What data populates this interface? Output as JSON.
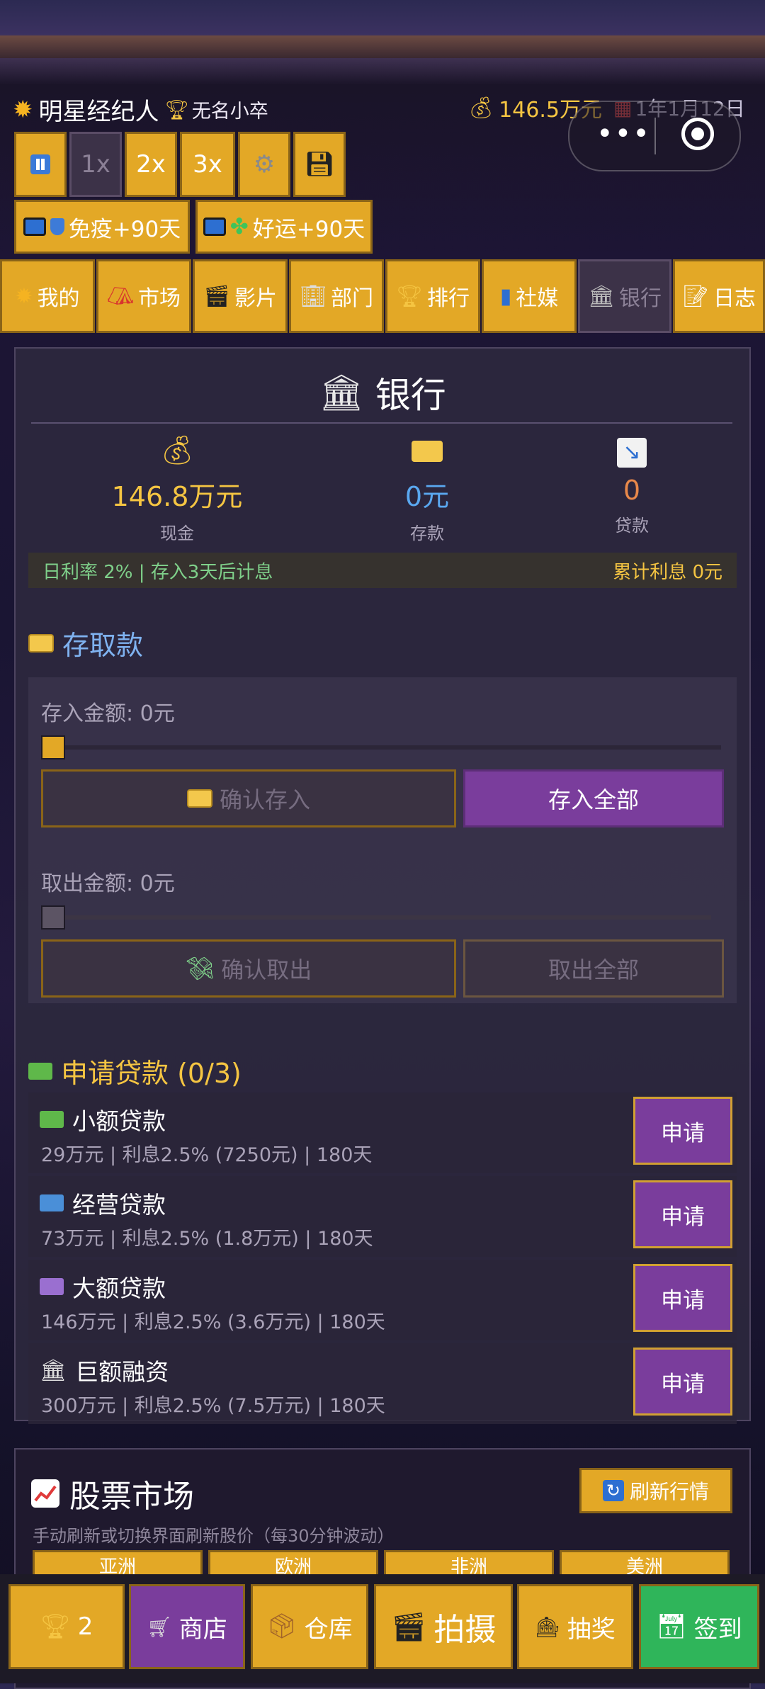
{
  "header": {
    "app_name": "明星经纪人",
    "rank": "无名小卒",
    "money": "146.5万元",
    "date": "1年1月12日"
  },
  "speed_controls": {
    "speed_1x": "1x",
    "speed_2x": "2x",
    "speed_3x": "3x"
  },
  "buffs": [
    {
      "label": "免疫+90天"
    },
    {
      "label": "好运+90天"
    }
  ],
  "tabs": [
    {
      "label": "我的"
    },
    {
      "label": "市场"
    },
    {
      "label": "影片"
    },
    {
      "label": "部门"
    },
    {
      "label": "排行"
    },
    {
      "label": "社媒"
    },
    {
      "label": "银行"
    },
    {
      "label": "日志"
    }
  ],
  "bank": {
    "title": "银行",
    "cash_value": "146.8万元",
    "cash_label": "现金",
    "deposit_value": "0元",
    "deposit_label": "存款",
    "loan_value": "0",
    "loan_label": "贷款",
    "rate_text": "日利率 2% | 存入3天后计息",
    "interest_text": "累计利息 0元"
  },
  "deposit_withdraw": {
    "title": "存取款",
    "deposit_amount_label": "存入金额: 0元",
    "confirm_deposit": "确认存入",
    "deposit_all": "存入全部",
    "withdraw_amount_label": "取出金额: 0元",
    "confirm_withdraw": "确认取出",
    "withdraw_all": "取出全部"
  },
  "loans": {
    "title": "申请贷款 (0/3)",
    "items": [
      {
        "name": "小额贷款",
        "detail": "29万元 | 利息2.5% (7250元) | 180天",
        "button": "申请"
      },
      {
        "name": "经营贷款",
        "detail": "73万元 | 利息2.5% (1.8万元) | 180天",
        "button": "申请"
      },
      {
        "name": "大额贷款",
        "detail": "146万元 | 利息2.5% (3.6万元) | 180天",
        "button": "申请"
      },
      {
        "name": "巨额融资",
        "detail": "300万元 | 利息2.5% (7.5万元) | 180天",
        "button": "申请"
      }
    ]
  },
  "stock": {
    "title": "股票市场",
    "refresh": "刷新行情",
    "note": "手动刷新或切换界面刷新股价（每30分钟波动）",
    "regions": [
      "亚洲",
      "欧洲",
      "非洲",
      "美洲"
    ]
  },
  "bottom_bar": {
    "trophy_count": "2",
    "shop": "商店",
    "warehouse": "仓库",
    "shoot": "拍摄",
    "lottery": "抽奖",
    "checkin": "签到"
  },
  "colors": {
    "gold": "#e3a826",
    "purple": "#7a3d9c",
    "green": "#2fb55a",
    "money_yellow": "#f5c542",
    "deposit_blue": "#5aa8f0",
    "loan_orange": "#e8884a"
  }
}
